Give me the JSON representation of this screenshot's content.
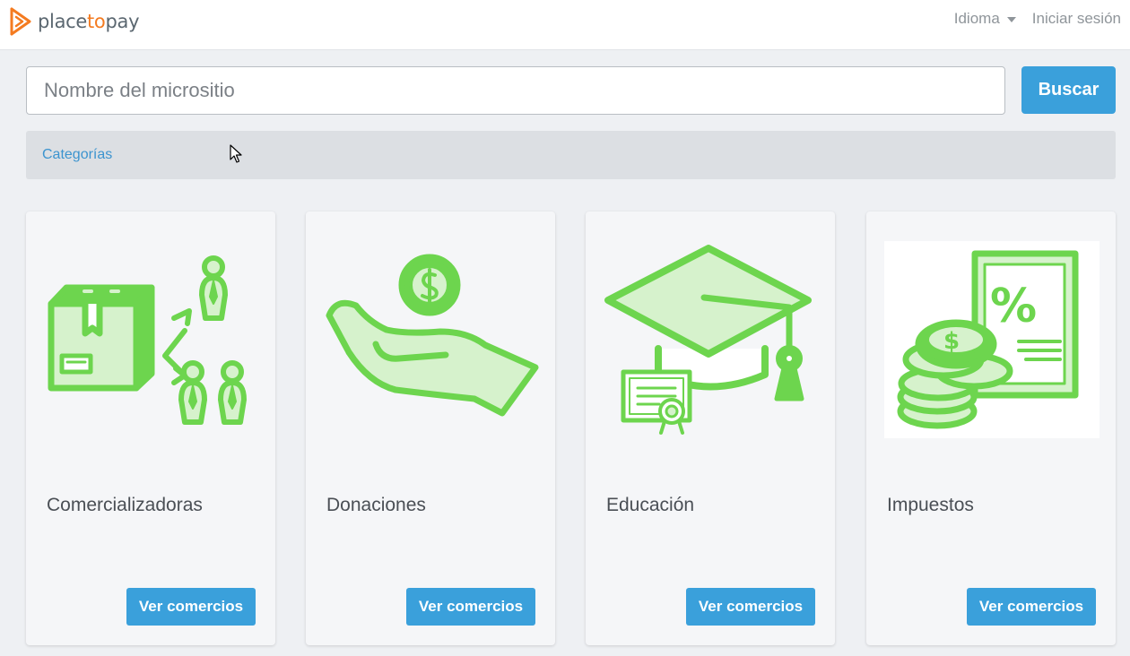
{
  "brand": {
    "part1": "place",
    "part2": "to",
    "part3": "pay",
    "accent_color": "#f47b20",
    "icon": "play-triangle-logo-icon"
  },
  "nav": {
    "language_label": "Idioma",
    "login_label": "Iniciar sesión"
  },
  "search": {
    "placeholder": "Nombre del micrositio",
    "value": "",
    "button_label": "Buscar"
  },
  "categories_link": "Categorías",
  "colors": {
    "primary": "#3aa0db",
    "icon_green": "#6dd54e",
    "icon_fill": "#d6f2cc",
    "background": "#eef0f3"
  },
  "cards": [
    {
      "title": "Comercializadoras",
      "button_label": "Ver comercios",
      "icon": "box-and-people-icon"
    },
    {
      "title": "Donaciones",
      "button_label": "Ver comercios",
      "icon": "hand-with-coin-icon"
    },
    {
      "title": "Educación",
      "button_label": "Ver comercios",
      "icon": "graduation-cap-diploma-icon"
    },
    {
      "title": "Impuestos",
      "button_label": "Ver comercios",
      "icon": "coins-and-tax-document-icon"
    }
  ]
}
